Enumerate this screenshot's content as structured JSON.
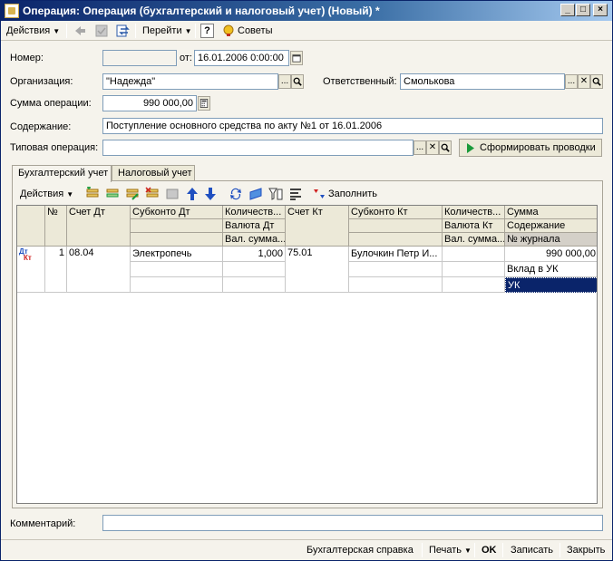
{
  "window": {
    "title": "Операция: Операция (бухгалтерский и налоговый учет) (Новый) *"
  },
  "toolbar": {
    "actions_label": "Действия",
    "goto_label": "Перейти",
    "help_label": "?",
    "tips_label": "Советы"
  },
  "form": {
    "number_label": "Номер:",
    "number_value": "",
    "date_label": "от:",
    "date_value": "16.01.2006  0:00:00",
    "org_label": "Организация:",
    "org_value": "\"Надежда\"",
    "responsible_label": "Ответственный:",
    "responsible_value": "Смолькова",
    "sum_label": "Сумма операции:",
    "sum_value": "990 000,00",
    "content_label": "Содержание:",
    "content_value": "Поступление основного средства по акту №1 от 16.01.2006",
    "typical_label": "Типовая операция:",
    "typical_value": "",
    "generate_label": "Сформировать проводки",
    "comment_label": "Комментарий:",
    "comment_value": ""
  },
  "tabs": [
    {
      "label": "Бухгалтерский учет",
      "active": true
    },
    {
      "label": "Налоговый учет",
      "active": false
    }
  ],
  "grid_toolbar": {
    "actions_label": "Действия",
    "fill_label": "Заполнить"
  },
  "grid": {
    "headers": {
      "num": "№",
      "acc_dt": "Счет Дт",
      "subconto_dt": "Субконто Дт",
      "qty_dt": "Количеств...",
      "currency_dt": "Валюта Дт",
      "cur_sum_dt": "Вал. сумма...",
      "acc_kt": "Счет Кт",
      "subconto_kt": "Субконто Кт",
      "qty_kt": "Количеств...",
      "currency_kt": "Валюта Кт",
      "cur_sum_kt": "Вал. сумма...",
      "sum": "Сумма",
      "content": "Содержание",
      "journal": "№ журнала"
    },
    "row": {
      "icon_dt": "Дт",
      "icon_kt": "Кт",
      "num": "1",
      "acc_dt": "08.04",
      "subconto_dt": "Электропечь",
      "qty_dt": "1,000",
      "acc_kt": "75.01",
      "subconto_kt": "Булочкин Петр И...",
      "sum": "990 000,00",
      "content": "Вклад в УК",
      "journal": "УК"
    }
  },
  "statusbar": {
    "accounting_ref": "Бухгалтерская справка",
    "print_label": "Печать",
    "ok_label": "OK",
    "save_label": "Записать",
    "close_label": "Закрыть"
  },
  "colors": {
    "title_bar": "#0a246a",
    "selection": "#0a246a",
    "generate_icon": "#1a9a3a"
  }
}
